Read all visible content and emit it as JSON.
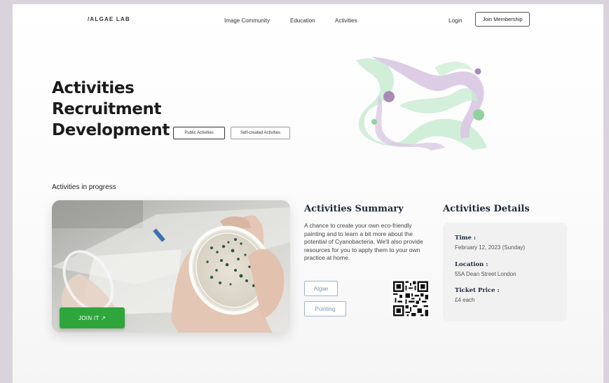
{
  "header": {
    "logo": "/ALGAE LAB",
    "nav": [
      "Image Community",
      "Education",
      "Activities"
    ],
    "login": "Login",
    "join_membership": "Join Membership"
  },
  "hero": {
    "title_lines": [
      "Activities",
      "Recruitment",
      "Development"
    ],
    "chips": [
      "Public Activities",
      "Self-created Activities"
    ]
  },
  "activities": {
    "section_title": "Activities in progress",
    "join_button": "JOIN IT ↗",
    "summary": {
      "title": "Activities Summary",
      "text": "A chance to create your own eco-friendly painting and to learn a bit more about the potential of Cyanobacteria. We'll also provide resources for you to apply them to your own practice at home.",
      "tags": [
        "Algae",
        "Pointing"
      ]
    },
    "details": {
      "title": "Activities Details",
      "time_label": "Time :",
      "time_value": "February 12, 2023 (Sunday)",
      "location_label": "Location :",
      "location_value": "55A Dean Street London",
      "price_label": "Ticket Price :",
      "price_value": "£4 each"
    }
  },
  "colors": {
    "accent_green": "#2ea63c",
    "light_green": "#c9ebd2",
    "lavender": "#d8c6e2",
    "purple_dot": "#a98bb8"
  }
}
